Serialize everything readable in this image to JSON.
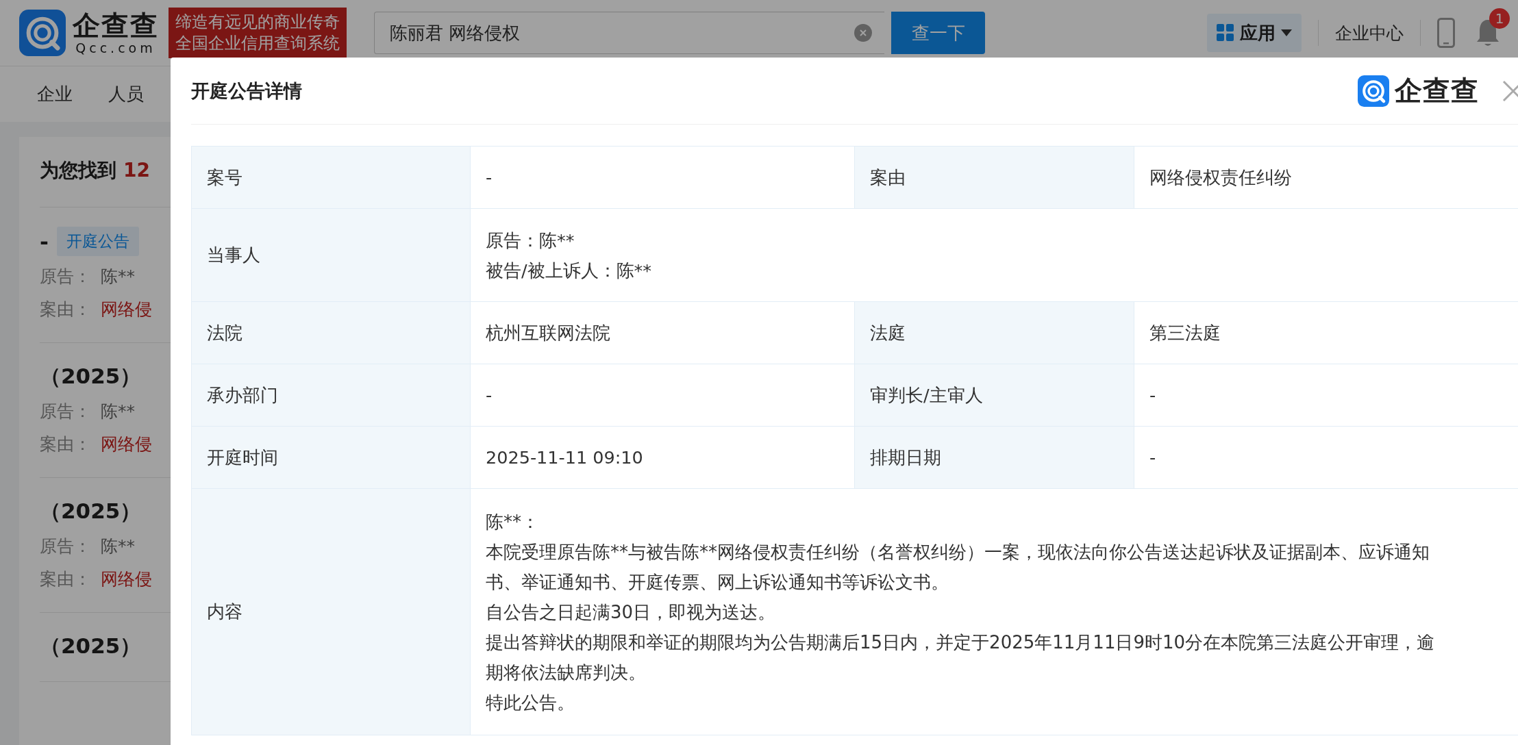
{
  "header": {
    "logo": {
      "name": "企查查",
      "domain": "Qcc.com"
    },
    "slogan": [
      "缔造有远见的商业传奇",
      "全国企业信用查询系统"
    ],
    "search": {
      "value": "陈丽君 网络侵权"
    },
    "search_button": "查一下",
    "apps_button": "应用",
    "enterprise_center": "企业中心",
    "notification_badge": "1"
  },
  "nav": [
    "企业",
    "人员"
  ],
  "results": {
    "summary_prefix": "为您找到",
    "count": "12",
    "items": [
      {
        "title": "-",
        "tag": "开庭公告",
        "lines": [
          {
            "label": "原告：",
            "value": "陈**",
            "kind": "plain"
          },
          {
            "label": "案由：",
            "value": "网络侵",
            "kind": "cause"
          }
        ]
      },
      {
        "title": "（2025）",
        "lines": [
          {
            "label": "原告：",
            "value": "陈**",
            "kind": "plain"
          },
          {
            "label": "案由：",
            "value": "网络侵",
            "kind": "cause"
          }
        ]
      },
      {
        "title": "（2025）",
        "lines": [
          {
            "label": "原告：",
            "value": "陈**",
            "kind": "plain"
          },
          {
            "label": "案由：",
            "value": "网络侵",
            "kind": "cause"
          }
        ]
      },
      {
        "title": "（2025）"
      }
    ]
  },
  "modal": {
    "title": "开庭公告详情",
    "brand": "企查查",
    "rows": [
      {
        "kind": "pair",
        "cells": [
          {
            "label": "案号",
            "value": "-"
          },
          {
            "label": "案由",
            "value": "网络侵权责任纠纷"
          }
        ]
      },
      {
        "kind": "lines",
        "label": "当事人",
        "lines": [
          "原告：陈**",
          "被告/被上诉人：陈**"
        ]
      },
      {
        "kind": "pair",
        "cells": [
          {
            "label": "法院",
            "value": "杭州互联网法院"
          },
          {
            "label": "法庭",
            "value": "第三法庭"
          }
        ]
      },
      {
        "kind": "pair",
        "cells": [
          {
            "label": "承办部门",
            "value": "-"
          },
          {
            "label": "审判长/主审人",
            "value": "-"
          }
        ]
      },
      {
        "kind": "pair",
        "cells": [
          {
            "label": "开庭时间",
            "value": "2025-11-11 09:10"
          },
          {
            "label": "排期日期",
            "value": "-"
          }
        ]
      },
      {
        "kind": "content",
        "label": "内容",
        "lines": [
          "陈**：",
          "本院受理原告陈**与被告陈**网络侵权责任纠纷（名誉权纠纷）一案，现依法向你公告送达起诉状及证据副本、应诉通知书、举证通知书、开庭传票、网上诉讼通知书等诉讼文书。",
          "自公告之日起满30日，即视为送达。",
          "提出答辩状的期限和举证的期限均为公告期满后15日内，并定于2025年11月11日9时10分在本院第三法庭公开审理，逾期将依法缺席判决。",
          "特此公告。"
        ]
      }
    ]
  }
}
